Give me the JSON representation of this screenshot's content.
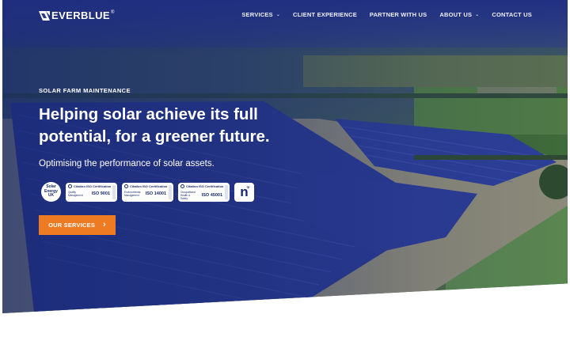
{
  "brand": {
    "name": "EVERBLUE",
    "registered": "®"
  },
  "nav": {
    "items": [
      {
        "label": "SERVICES",
        "has_dropdown": true
      },
      {
        "label": "CLIENT EXPERIENCE",
        "has_dropdown": false
      },
      {
        "label": "PARTNER WITH US",
        "has_dropdown": false
      },
      {
        "label": "ABOUT US",
        "has_dropdown": true
      },
      {
        "label": "CONTACT US",
        "has_dropdown": false
      }
    ],
    "chevron": "⌄"
  },
  "hero": {
    "eyebrow": "SOLAR FARM MAINTENANCE",
    "headline": "Helping solar achieve its full potential, for a greener future.",
    "subheadline": "Optimising the performance of solar assets.",
    "cta_label": "OUR SERVICES",
    "cta_icon": "›"
  },
  "badges": {
    "solar_energy_uk": [
      "Solar",
      "Energy",
      "UK"
    ],
    "iso": [
      {
        "issuer": "Citation ISO Certification",
        "desc": "Quality Management",
        "code": "ISO 9001"
      },
      {
        "issuer": "Citation ISO Certification",
        "desc": "Environmental Management",
        "code": "ISO 14001"
      },
      {
        "issuer": "Citation ISO Certification",
        "desc": "Occupational Health & Safety",
        "code": "ISO 45001"
      }
    ],
    "n_badge": "n"
  },
  "colors": {
    "accent": "#ee7a22",
    "overlay": "#1f2f86",
    "text": "#ffffff"
  }
}
